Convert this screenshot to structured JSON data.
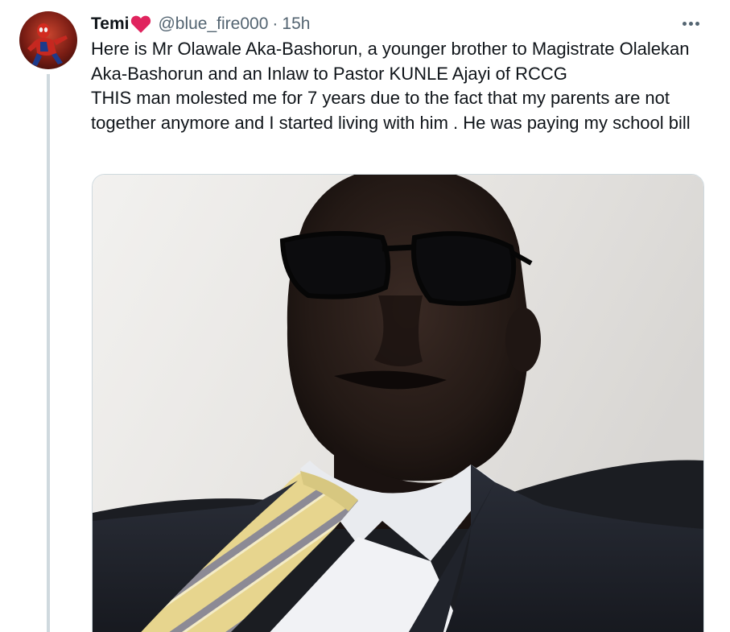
{
  "tweet": {
    "author": {
      "display_name": "Temi",
      "handle": "@blue_fire000",
      "avatar_icon": "spiderman-avatar-icon",
      "name_badge_icon": "red-heart-icon"
    },
    "separator": "·",
    "timestamp": "15h",
    "more_icon": "more-dots-icon",
    "text": "Here is Mr Olawale Aka-Bashorun, a younger brother to Magistrate Olalekan Aka-Bashorun and an Inlaw to Pastor KUNLE Ajayi of RCCG\nTHIS man molested me for 7 years due to the fact that my parents are not together anymore and I started living with him . He was paying my school bill",
    "media": {
      "type": "photo",
      "subject": "man-in-suit-photo"
    }
  },
  "colors": {
    "text_primary": "#0f1419",
    "text_secondary": "#536471",
    "border": "#cfd9de",
    "heart": "#e0245e"
  }
}
